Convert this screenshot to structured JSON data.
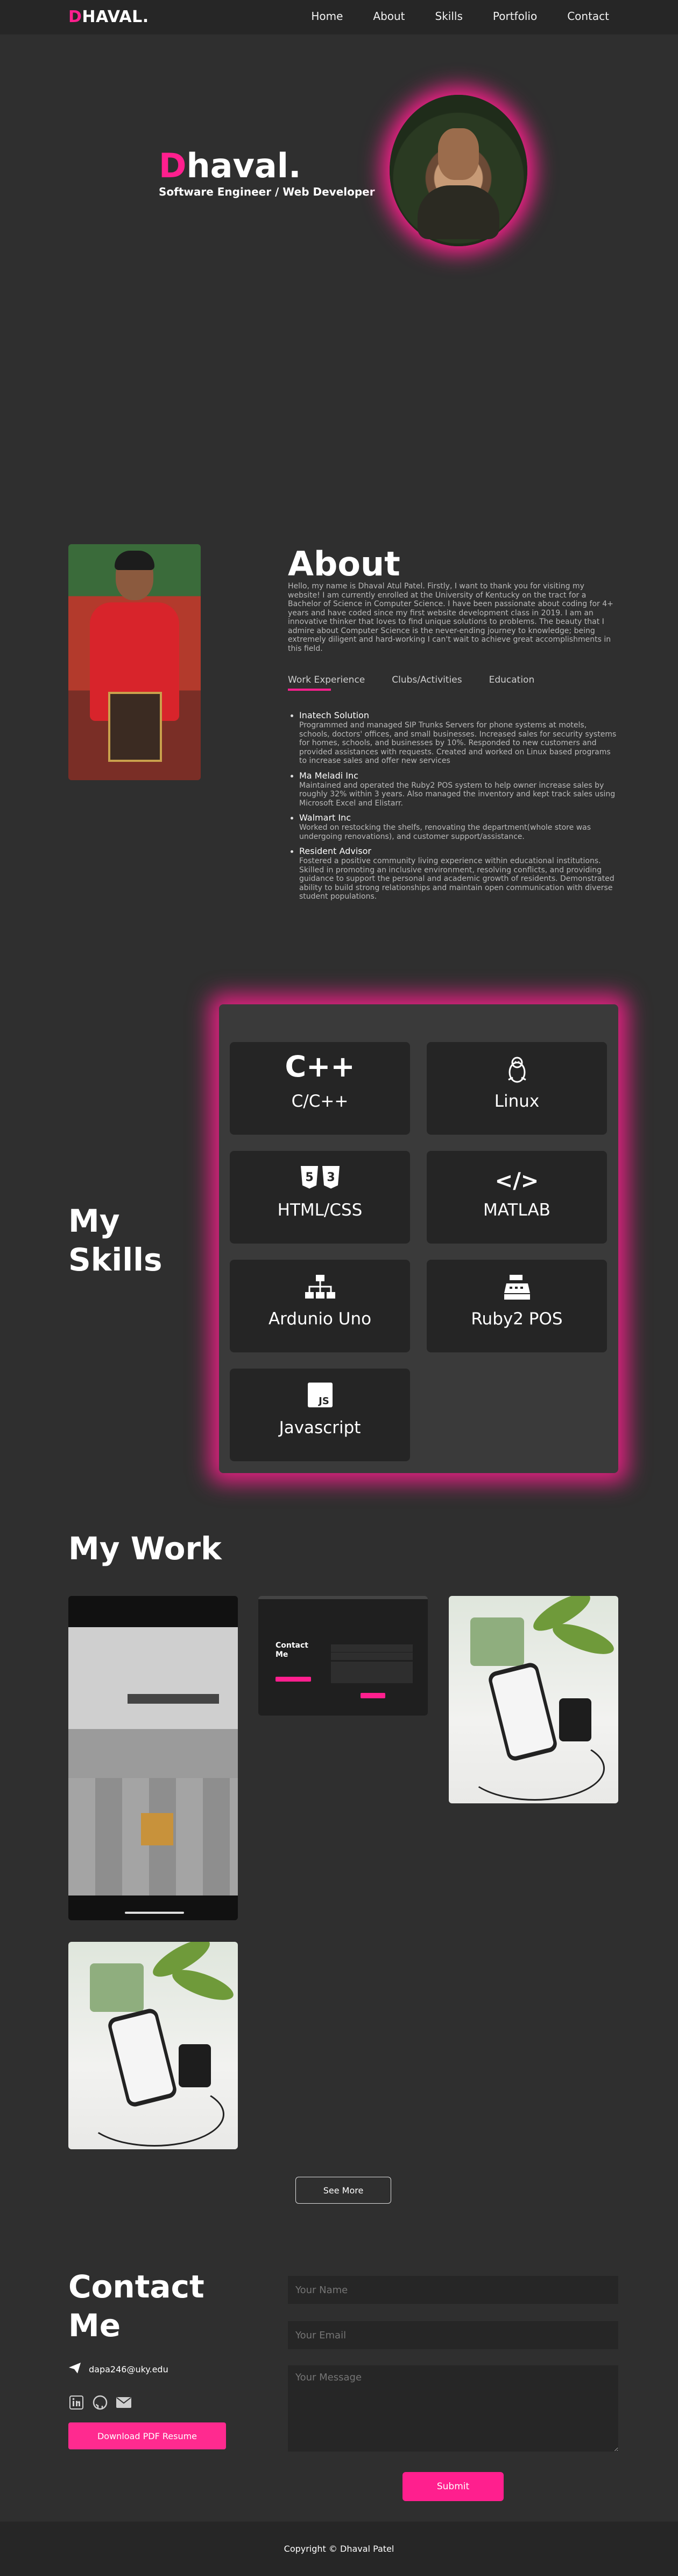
{
  "brand": {
    "initial": "D",
    "rest": "HAVAL."
  },
  "nav": [
    "Home",
    "About",
    "Skills",
    "Portfolio",
    "Contact"
  ],
  "hero": {
    "name_initial": "D",
    "name_rest": "haval.",
    "title": "Software Engineer / Web Developer"
  },
  "about": {
    "heading": "About",
    "bio": "Hello, my name is Dhaval Atul Patel. Firstly, I want to thank you for visiting my website! I am currently enrolled at the University of Kentucky on the tract for a Bachelor of Science in Computer Science. I have been passionate about coding for 4+ years and have coded since my first website development class in 2019. I am an innovative thinker that loves to find unique solutions to problems. The beauty that I admire about Computer Science is the never-ending journey to knowledge; being extremely diligent and hard-working I can't wait to achieve great accomplishments in this field.",
    "tabs": [
      "Work Experience",
      "Clubs/Activities",
      "Education"
    ],
    "experience": [
      {
        "title": "Inatech Solution",
        "desc": "Programmed and managed SIP Trunks Servers for phone systems at motels, schools, doctors' offices, and small businesses. Increased sales for security systems for homes, schools, and businesses by 10%. Responded to new customers and provided assistances with requests. Created and worked on Linux based programs to increase sales and offer new services"
      },
      {
        "title": "Ma Meladi Inc",
        "desc": "Maintained and operated the Ruby2 POS system to help owner increase sales by roughly 32% within 3 years. Also managed the inventory and kept track sales using Microsoft Excel and Elistarr."
      },
      {
        "title": "Walmart Inc",
        "desc": "Worked on restocking the shelfs, renovating the department(whole store was undergoing renovations), and customer support/assistance."
      },
      {
        "title": "Resident Advisor",
        "desc": "Fostered a positive community living experience within educational institutions. Skilled in promoting an inclusive environment, resolving conflicts, and providing guidance to support the personal and academic growth of residents. Demonstrated ability to build strong relationships and maintain open communication with diverse student populations."
      }
    ]
  },
  "skills": {
    "heading_line1": "My",
    "heading_line2": "Skills",
    "items": [
      {
        "icon": "cpp-icon",
        "glyph": "C++",
        "label": "C/C++"
      },
      {
        "icon": "linux-tux-icon",
        "glyph": "",
        "label": "Linux"
      },
      {
        "icon": "html5-css3-icon",
        "glyph": "",
        "label": "HTML/CSS"
      },
      {
        "icon": "code-brackets-icon",
        "glyph": "</>",
        "label": "MATLAB"
      },
      {
        "icon": "network-sitemap-icon",
        "glyph": "",
        "label": "Ardunio Uno"
      },
      {
        "icon": "cash-register-icon",
        "glyph": "",
        "label": "Ruby2 POS"
      },
      {
        "icon": "javascript-js-icon",
        "glyph": "JS",
        "label": "Javascript"
      }
    ]
  },
  "work": {
    "heading": "My Work",
    "thumb_contact_line1": "Contact",
    "thumb_contact_line2": "Me",
    "see_more": "See More"
  },
  "contact": {
    "heading_line1": "Contact",
    "heading_line2": "Me",
    "email": "dapa246@uky.edu",
    "download_label": "Download PDF Resume",
    "name_placeholder": "Your Name",
    "email_placeholder": "Your Email",
    "message_placeholder": "Your Message",
    "submit_label": "Submit"
  },
  "footer": {
    "text": "Copyright © Dhaval Patel"
  },
  "colors": {
    "accent": "#ff1f8e",
    "background": "#2f2f2f",
    "dark": "#262626"
  }
}
